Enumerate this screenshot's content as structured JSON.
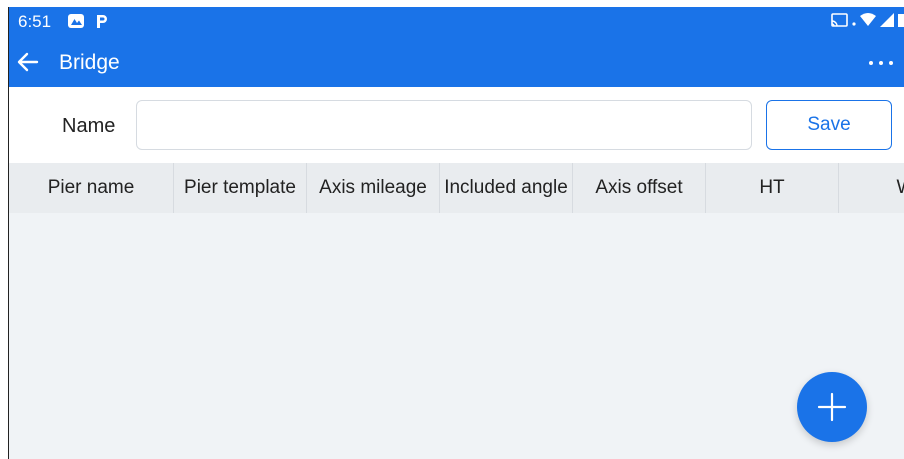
{
  "status_bar": {
    "time": "6:51",
    "left_icons": [
      "gallery-notification-icon",
      "p-notification-icon"
    ],
    "right_icons": [
      "cast-icon",
      "wifi-icon",
      "signal-icon",
      "battery-icon"
    ]
  },
  "appbar": {
    "title": "Bridge",
    "back_icon": "arrow-left-icon",
    "more_icon": "more-horizontal-icon"
  },
  "form": {
    "name_label": "Name",
    "name_value": "",
    "save_label": "Save"
  },
  "table": {
    "columns": [
      "Pier name",
      "Pier template",
      "Axis mileage",
      "Included angle",
      "Axis offset",
      "HT",
      "W"
    ]
  },
  "fab": {
    "icon": "plus-icon"
  },
  "colors": {
    "primary": "#1a73e8",
    "background": "#f0f3f6",
    "header_bg": "#e9ecef"
  }
}
